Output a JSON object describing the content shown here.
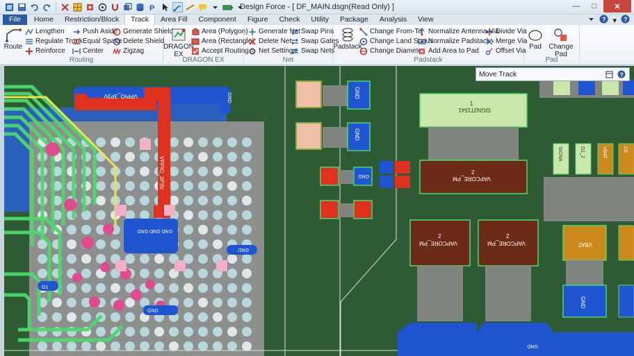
{
  "window": {
    "title": "Design Force - [ DF_MAIN.dsgn(Read Only) ]",
    "min_glyph": "—",
    "max_glyph": "□",
    "close_glyph": "✕"
  },
  "tabs": [
    {
      "label": "File"
    },
    {
      "label": "Home"
    },
    {
      "label": "Restriction/Block"
    },
    {
      "label": "Track"
    },
    {
      "label": "Area Fill"
    },
    {
      "label": "Component"
    },
    {
      "label": "Figure"
    },
    {
      "label": "Check"
    },
    {
      "label": "Utility"
    },
    {
      "label": "Package"
    },
    {
      "label": "Analysis"
    },
    {
      "label": "View"
    }
  ],
  "tabs_right": {
    "help_glyph": "?",
    "caret": "▾"
  },
  "groups": {
    "routing": {
      "label": "Routing",
      "route": "Route",
      "col1": [
        "Lengthen",
        "Regulate Trunk",
        "Reinforce"
      ],
      "col2": [
        "Push Aside",
        "Equal Space",
        "Center"
      ],
      "col3": [
        "Generate Shield",
        "Delete Shield",
        "Zigzag"
      ]
    },
    "dragon": {
      "label": "DRAGON EX",
      "big_line1": "DRAGON",
      "big_line2": "EX",
      "col": [
        "Area (Polygon)",
        "Area (Rectangle)",
        "Accept Routing"
      ]
    },
    "net": {
      "label": "Net",
      "col1": [
        "Generate Net",
        "Delete Net",
        "Net Settings"
      ],
      "col2": [
        "Swap Pins",
        "Swap Gates",
        "Swap Nets"
      ]
    },
    "padstack": {
      "label": "Padstack",
      "big": "Padstack",
      "col1": [
        "Change From-To",
        "Change Land Status",
        "Change Diameter"
      ],
      "col2": [
        "Normalize Antenna Via",
        "Normalize Padstack",
        "Add Area to Pad"
      ],
      "col3": [
        "Divide Via",
        "Merge Via",
        "Offset Via"
      ]
    },
    "pad": {
      "label": "Pad",
      "big1": "Pad",
      "big2": "Change Pad"
    }
  },
  "panel": {
    "title": "Move Track"
  },
  "board": {
    "nets": {
      "gnd": "GND",
      "vppio": "VPPIO_3P3V",
      "vppio_v": "VPPIO_3P3V",
      "gnd_stack": "GND GND GND",
      "sig1": "SIGN3T1541",
      "vapcore": "VAPCORE_PM",
      "vbat": "VBAT",
      "d12": "D1_2",
      "d2": "D2",
      "sig": "SIGNA",
      "g1": "G1",
      "d1": "D1",
      "num1": "1",
      "num2": "2"
    },
    "colors": {
      "board": "#2e5a34",
      "bga": "#8c8f8c",
      "green_trace": "#4cd96d",
      "yellow_trace": "#f0e34a",
      "red_trace": "#e0311f",
      "blue_plane": "#1f55d0",
      "pink_pad": "#e24a8f",
      "brown_pad": "#6b2b16",
      "pale_pad": "#c9e7a8",
      "orange_pad": "#cc8a1c"
    }
  }
}
